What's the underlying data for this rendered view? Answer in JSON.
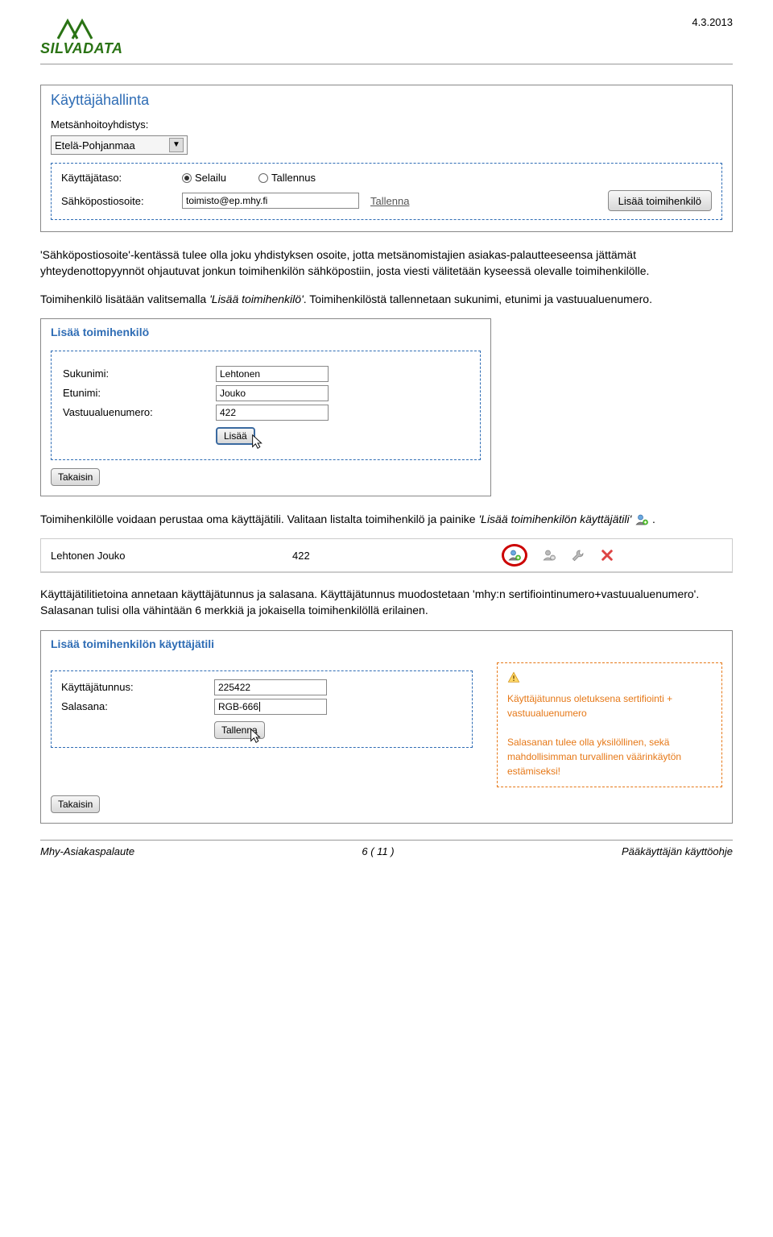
{
  "header": {
    "brand": "SILVADATA",
    "date": "4.3.2013"
  },
  "panel1": {
    "title": "Käyttäjähallinta",
    "assoc_label": "Metsänhoitoyhdistys:",
    "assoc_value": "Etelä-Pohjanmaa",
    "level_label": "Käyttäjätaso:",
    "radio1": "Selailu",
    "radio2": "Tallennus",
    "email_label": "Sähköpostiosoite:",
    "email_value": "toimisto@ep.mhy.fi",
    "save_link": "Tallenna",
    "add_button": "Lisää toimihenkilö"
  },
  "para1": "'Sähköpostiosoite'-kentässä tulee olla joku yhdistyksen osoite, jotta metsänomistajien asiakas-palautteeseensa jättämät yhteydenottopyynnöt ohjautuvat jonkun toimihenkilön sähköpostiin, josta viesti välitetään kyseessä olevalle toimihenkilölle.",
  "para2a": "Toimihenkilö lisätään valitsemalla ",
  "para2b": "'Lisää toimihenkilö'",
  "para2c": ". Toimihenkilöstä tallennetaan sukunimi, etunimi ja vastuualuenumero.",
  "panel2": {
    "title": "Lisää toimihenkilö",
    "lastname_label": "Sukunimi:",
    "lastname_value": "Lehtonen",
    "firstname_label": "Etunimi:",
    "firstname_value": "Jouko",
    "area_label": "Vastuualuenumero:",
    "area_value": "422",
    "add_btn": "Lisää",
    "back_btn": "Takaisin"
  },
  "para3a": "Toimihenkilölle voidaan perustaa oma käyttäjätili. Valitaan listalta toimihenkilö ja painike ",
  "para3b": "'Lisää toimihenkilön käyttäjätili'",
  "para3c": " .",
  "listrow": {
    "name": "Lehtonen Jouko",
    "num": "422"
  },
  "para4": "Käyttäjätilitietoina annetaan käyttäjätunnus ja salasana. Käyttäjätunnus muodostetaan 'mhy:n sertifiointinumero+vastuualuenumero'. Salasanan tulisi olla vähintään 6 merkkiä ja jokaisella toimihenkilöllä erilainen.",
  "panel3": {
    "title": "Lisää toimihenkilön käyttäjätili",
    "user_label": "Käyttäjätunnus:",
    "user_value": "225422",
    "pass_label": "Salasana:",
    "pass_value": "RGB-666",
    "save_btn": "Tallenna",
    "back_btn": "Takaisin",
    "warn1": "Käyttäjätunnus oletuksena sertifiointi + vastuualuenumero",
    "warn2": "Salasanan tulee olla yksilöllinen, sekä mahdollisimman turvallinen väärinkäytön estämiseksi!"
  },
  "footer": {
    "left": "Mhy-Asiakaspalaute",
    "center": "6 ( 11 )",
    "right": "Pääkäyttäjän käyttöohje"
  }
}
